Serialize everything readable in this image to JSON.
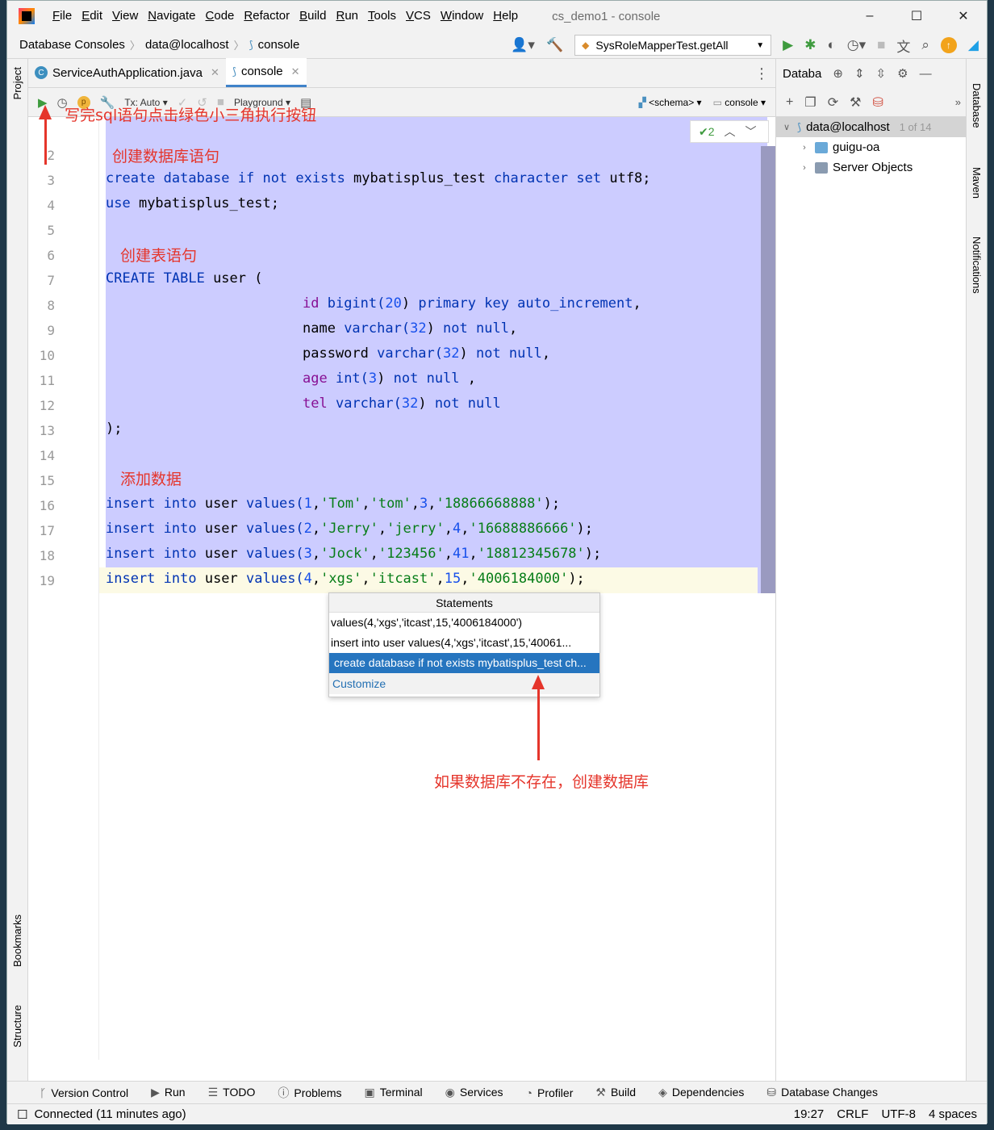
{
  "window": {
    "title": "cs_demo1 - console",
    "menu": [
      "File",
      "Edit",
      "View",
      "Navigate",
      "Code",
      "Refactor",
      "Build",
      "Run",
      "Tools",
      "VCS",
      "Window",
      "Help"
    ],
    "controls": {
      "minimize": "–",
      "maximize": "☐",
      "close": "✕"
    }
  },
  "navbar": {
    "breadcrumbs": [
      "Database Consoles",
      "data@localhost",
      "console"
    ],
    "run_config": "SysRoleMapperTest.getAll"
  },
  "tabs": [
    {
      "label": "ServiceAuthApplication.java",
      "active": false
    },
    {
      "label": "console",
      "active": true
    }
  ],
  "toolbar": {
    "tx_label": "Tx: Auto",
    "playground_label": "Playground",
    "schema_label": "<schema>",
    "console_label": "console",
    "inspection_count": "2"
  },
  "annotations": {
    "run_hint": "写完sql语句点击绿色小三角执行按钮",
    "create_db_note": "创建数据库语句",
    "create_table_note": "创建表语句",
    "insert_note": "添加数据",
    "popup_note": "如果数据库不存在，创建数据库"
  },
  "line_numbers": [
    "2",
    "3",
    "4",
    "5",
    "6",
    "7",
    "8",
    "9",
    "10",
    "11",
    "12",
    "13",
    "14",
    "15",
    "16",
    "17",
    "18",
    "19"
  ],
  "code": {
    "l3": [
      "create database if not exists ",
      "mybatisplus_test",
      " character set ",
      "utf8;"
    ],
    "l4": [
      "use ",
      "mybatisplus_test;"
    ],
    "l7": [
      "CREATE TABLE ",
      "user ("
    ],
    "l8": [
      "id ",
      "bigint(",
      "20",
      ") ",
      "primary key auto_increment",
      ","
    ],
    "l9": [
      "name ",
      "varchar(",
      "32",
      ") ",
      "not null",
      ","
    ],
    "l10": [
      "password ",
      "varchar(",
      "32",
      ") ",
      "not null",
      ","
    ],
    "l11": [
      "age ",
      "int(",
      "3",
      ") ",
      "not null",
      " ,"
    ],
    "l12": [
      "tel ",
      "varchar(",
      "32",
      ") ",
      "not null"
    ],
    "l13": ");",
    "inserts": [
      [
        "insert into ",
        "user ",
        "values(",
        "1",
        ",",
        "'Tom'",
        ",",
        "'tom'",
        ",",
        "3",
        ",",
        "'18866668888'",
        ");"
      ],
      [
        "insert into ",
        "user ",
        "values(",
        "2",
        ",",
        "'Jerry'",
        ",",
        "'jerry'",
        ",",
        "4",
        ",",
        "'16688886666'",
        ");"
      ],
      [
        "insert into ",
        "user ",
        "values(",
        "3",
        ",",
        "'Jock'",
        ",",
        "'123456'",
        ",",
        "41",
        ",",
        "'18812345678'",
        ");"
      ],
      [
        "insert into ",
        "user ",
        "values(",
        "4",
        ",",
        "'xgs'",
        ",",
        "'itcast'",
        ",",
        "15",
        ",",
        "'4006184000'",
        ");"
      ]
    ]
  },
  "popup": {
    "title": "Statements",
    "items": [
      "values(4,'xgs','itcast',15,'4006184000')",
      "insert into user values(4,'xgs','itcast',15,'40061...",
      "create database if not exists mybatisplus_test ch..."
    ],
    "selected_index": 2,
    "customize": "Customize"
  },
  "db_pane": {
    "title": "Databa",
    "tree": [
      {
        "label": "data@localhost",
        "count": "1 of 14"
      },
      {
        "label": "guigu-oa"
      },
      {
        "label": "Server Objects"
      }
    ]
  },
  "side_labels": {
    "left": [
      "Project",
      "Bookmarks",
      "Structure"
    ],
    "right": [
      "Database",
      "Maven",
      "Notifications"
    ]
  },
  "bottom_tools": [
    "Version Control",
    "Run",
    "TODO",
    "Problems",
    "Terminal",
    "Services",
    "Profiler",
    "Build",
    "Dependencies",
    "Database Changes"
  ],
  "status": {
    "connection": "Connected (11 minutes ago)",
    "position": "19:27",
    "line_sep": "CRLF",
    "encoding": "UTF-8",
    "indent": "4 spaces"
  },
  "colors": {
    "accent": "#2675bf",
    "annotation": "#e5352b",
    "selection": "#ccccff"
  }
}
